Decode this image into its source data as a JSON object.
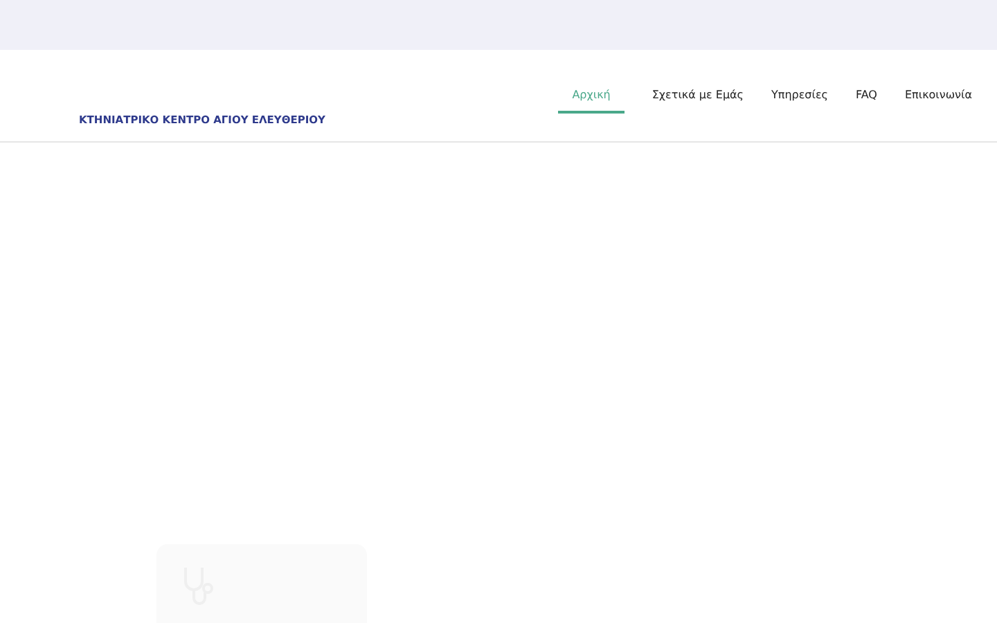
{
  "header": {
    "brand": "ΚΤΗΝΙΑΤΡΙΚΟ ΚΕΝΤΡΟ ΑΓΙΟΥ ΕΛΕΥΘΕΡΙΟΥ",
    "nav": [
      {
        "label": "Αρχική",
        "selected": true
      },
      {
        "label": "Σχετικά με Εμάς",
        "selected": false
      },
      {
        "label": "Υπηρεσίες",
        "selected": false
      },
      {
        "label": "FAQ",
        "selected": false
      },
      {
        "label": "Επικοινωνία",
        "selected": false
      }
    ]
  }
}
